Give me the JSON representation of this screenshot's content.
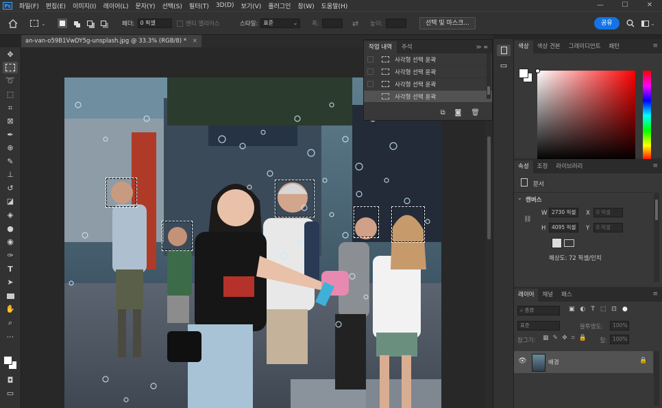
{
  "app": {
    "logo": "Ps"
  },
  "menu": [
    "파일(F)",
    "편집(E)",
    "이미지(I)",
    "레이어(L)",
    "문자(Y)",
    "선택(S)",
    "필터(T)",
    "3D(D)",
    "보기(V)",
    "플러그인",
    "창(W)",
    "도움말(H)"
  ],
  "window_controls": {
    "minimize": "—",
    "maximize": "☐",
    "close": "✕"
  },
  "options": {
    "feather_label": "페더:",
    "feather_value": "0 픽셀",
    "antialias_label": "앤티 앨리어스",
    "style_label": "스타일:",
    "style_value": "표준",
    "width_label": "폭:",
    "height_label": "높이:",
    "select_mask_button": "선택 및 마스크...",
    "share_button": "공유"
  },
  "document_tab": {
    "title": "an-van-o59B1VwDY5g-unsplash.jpg @ 33.3% (RGB/8) *",
    "close": "×"
  },
  "history_panel": {
    "tabs": [
      "작업 내역",
      "주석"
    ],
    "items": [
      "사각형 선택 윤곽",
      "사각형 선택 윤곽",
      "사각형 선택 윤곽",
      "사각형 선택 윤곽"
    ],
    "current_index": 3
  },
  "color_panel": {
    "tabs": [
      "색상",
      "색상 견본",
      "그레이디언트",
      "패턴"
    ],
    "foreground": "#ffffff",
    "background": "#ffffff",
    "hue": "#ff0000"
  },
  "properties_panel": {
    "tabs": [
      "속성",
      "조정",
      "라이브러리"
    ],
    "doc_label": "문서",
    "canvas_section": "캔버스",
    "w_label": "W",
    "w_value": "2730 픽셀",
    "h_label": "H",
    "h_value": "4095 픽셀",
    "x_label": "X",
    "x_value": "0 픽셀",
    "y_label": "Y",
    "y_value": "0 픽셀",
    "resolution": "해상도: 72 픽셀/인치"
  },
  "layers_panel": {
    "tabs": [
      "레이어",
      "채널",
      "패스"
    ],
    "filter_placeholder": "종류",
    "blend_mode": "표준",
    "opacity_label": "불투명도:",
    "opacity_value": "100%",
    "lock_label": "잠그기:",
    "fill_label": "칠:",
    "fill_value": "100%",
    "layers": [
      {
        "name": "배경",
        "visible": true,
        "locked": true
      }
    ]
  },
  "colors": {
    "accent": "#1473e6",
    "ui_bg": "#323232",
    "canvas_bg": "#282828"
  }
}
